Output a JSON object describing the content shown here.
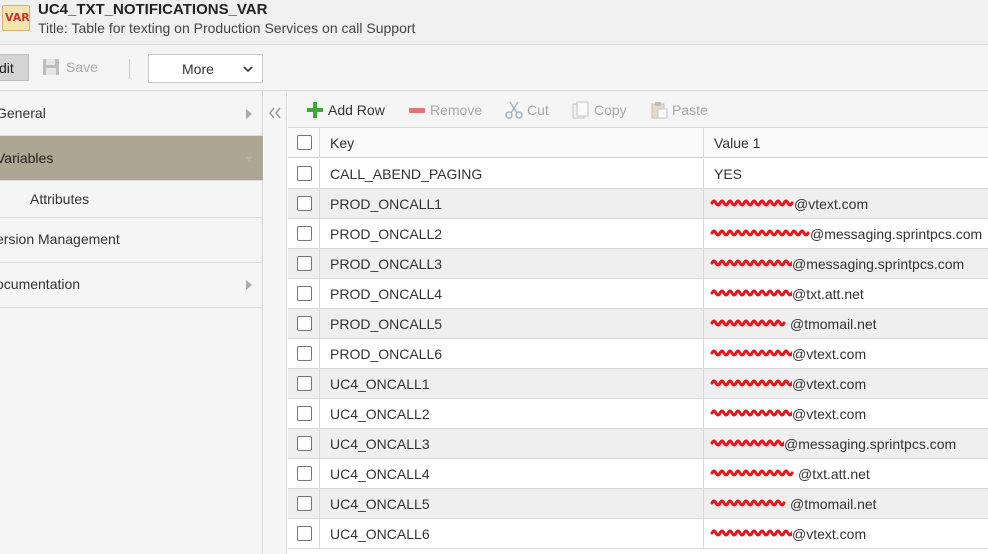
{
  "header": {
    "icon_text": "VAR",
    "object_name": "UC4_TXT_NOTIFICATIONS_VAR",
    "title_line": "Title: Table for texting on Production Services on call Support"
  },
  "toolbar": {
    "edit_label": "dit",
    "save_label": "Save",
    "more_label": "More"
  },
  "nav": {
    "items": [
      {
        "label": "General",
        "has_arrow": true
      },
      {
        "label": "Variables",
        "active": true
      },
      {
        "label": "Attributes",
        "sub": true
      },
      {
        "label": "ersion Management"
      },
      {
        "label": "ocumentation",
        "has_arrow": true
      }
    ]
  },
  "grid_toolbar": {
    "add_row": "Add Row",
    "remove": "Remove",
    "cut": "Cut",
    "copy": "Copy",
    "paste": "Paste"
  },
  "table": {
    "columns": [
      "Key",
      "Value 1"
    ],
    "rows": [
      {
        "key": "CALL_ABEND_PAGING",
        "value": "YES"
      },
      {
        "key": "PROD_ONCALL1",
        "value": "@vtext.com"
      },
      {
        "key": "PROD_ONCALL2",
        "value": "@messaging.sprintpcs.com"
      },
      {
        "key": "PROD_ONCALL3",
        "value": "@messaging.sprintpcs.com"
      },
      {
        "key": "PROD_ONCALL4",
        "value": "@txt.att.net"
      },
      {
        "key": "PROD_ONCALL5",
        "value": "@tmomail.net"
      },
      {
        "key": "PROD_ONCALL6",
        "value": "@vtext.com"
      },
      {
        "key": "UC4_ONCALL1",
        "value": "@vtext.com"
      },
      {
        "key": "UC4_ONCALL2",
        "value": "@vtext.com"
      },
      {
        "key": "UC4_ONCALL3",
        "value": "@messaging.sprintpcs.com"
      },
      {
        "key": "UC4_ONCALL4",
        "value": "@txt.att.net"
      },
      {
        "key": "UC4_ONCALL5",
        "value": "@tmomail.net"
      },
      {
        "key": "UC4_ONCALL6",
        "value": "@vtext.com"
      }
    ]
  },
  "colors": {
    "active_nav": "#aea593",
    "redaction": "#e8141b",
    "add_icon": "#3aa935",
    "remove_icon": "#e57373"
  }
}
